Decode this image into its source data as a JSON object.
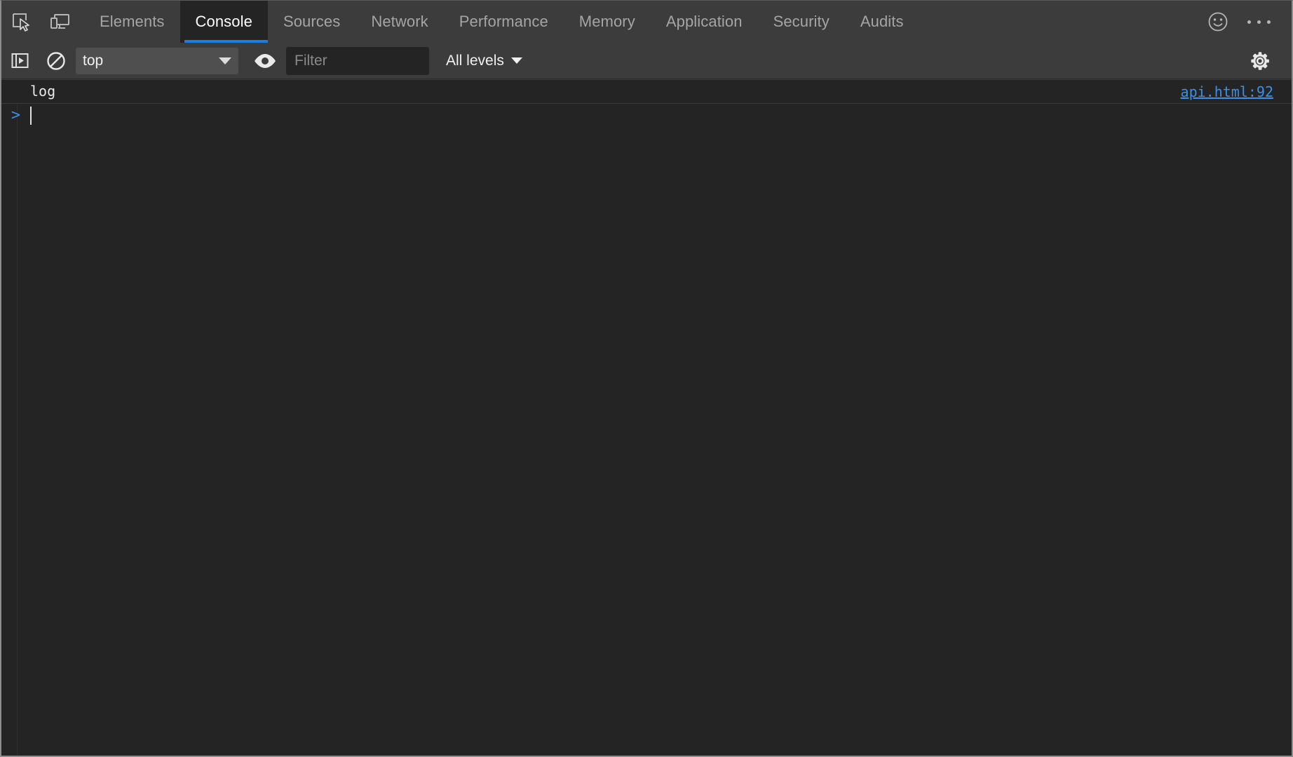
{
  "window": {
    "theme_background": "#242424",
    "toolbar_background": "#3c3c3c",
    "accent_color": "#1a7ee0",
    "link_color": "#3c90e8"
  },
  "tabbar": {
    "inspect_icon": "inspect-element-icon",
    "device_icon": "device-toolbar-icon",
    "tabs": [
      {
        "label": "Elements",
        "active": false
      },
      {
        "label": "Console",
        "active": true
      },
      {
        "label": "Sources",
        "active": false
      },
      {
        "label": "Network",
        "active": false
      },
      {
        "label": "Performance",
        "active": false
      },
      {
        "label": "Memory",
        "active": false
      },
      {
        "label": "Application",
        "active": false
      },
      {
        "label": "Security",
        "active": false
      },
      {
        "label": "Audits",
        "active": false
      }
    ],
    "feedback_icon": "smiley-face-icon",
    "more_icon": "more-options-icon"
  },
  "console_toolbar": {
    "sidebar_toggle_icon": "console-sidebar-toggle-icon",
    "clear_icon": "clear-console-icon",
    "context": {
      "selected": "top",
      "caret_icon": "chevron-down-icon"
    },
    "live_expression_icon": "eye-icon",
    "filter": {
      "value": "",
      "placeholder": "Filter"
    },
    "levels": {
      "label": "All levels",
      "caret_icon": "chevron-down-icon"
    },
    "settings_icon": "gear-icon"
  },
  "console_body": {
    "messages": [
      {
        "text": "log",
        "source": "api.html:92"
      }
    ],
    "prompt": {
      "arrow": ">",
      "value": ""
    }
  }
}
